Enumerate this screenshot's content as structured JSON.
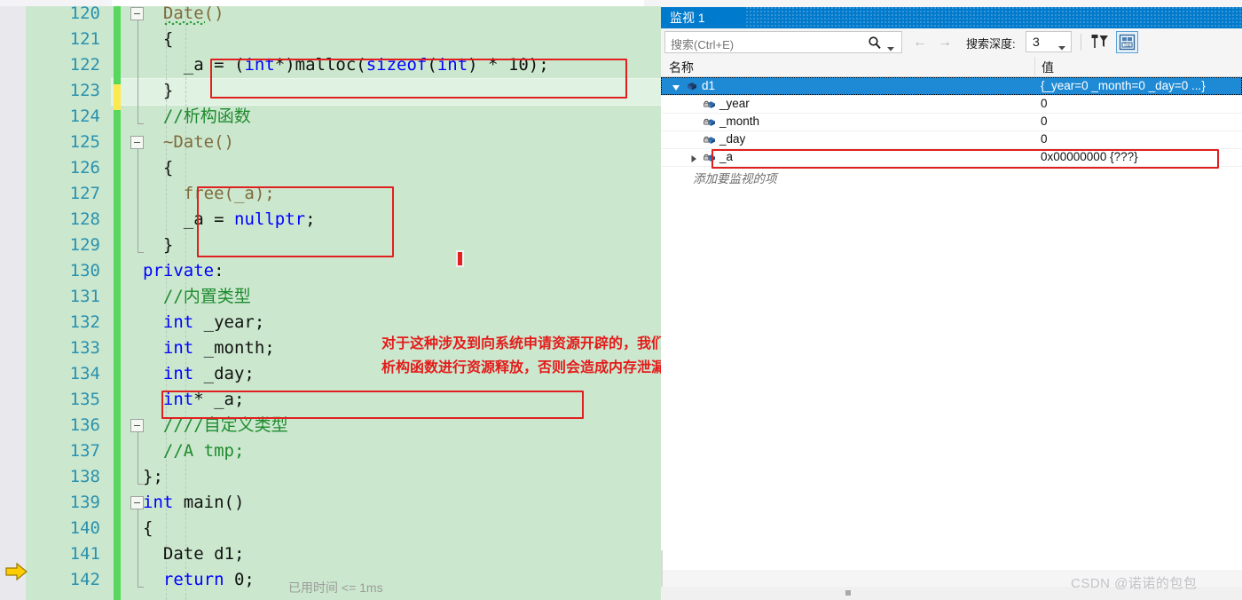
{
  "editor": {
    "first_line_number": 120,
    "line_height": 29,
    "colors": {
      "background": "#cbe8ce",
      "line_number": "#2b91af",
      "keyword": "#0000ff",
      "comment": "#1f8a2f",
      "function": "#7f6a3d",
      "change_bar": "#57d75c",
      "change_bar_unsaved": "#fce94f",
      "annotation": "#e41b1b",
      "highlight_box": "#e02020"
    },
    "lines": [
      {
        "num": "120",
        "tokens": [
          {
            "t": "Date()",
            "c": "fn"
          }
        ],
        "indent": 2,
        "fold": "open",
        "squiggle": true
      },
      {
        "num": "121",
        "tokens": [
          {
            "t": "{",
            "c": "plain"
          }
        ],
        "indent": 2
      },
      {
        "num": "122",
        "tokens": [
          {
            "t": "_a = (",
            "c": "plain"
          },
          {
            "t": "int",
            "c": "kw"
          },
          {
            "t": "*)malloc(",
            "c": "plain"
          },
          {
            "t": "sizeof",
            "c": "kw"
          },
          {
            "t": "(",
            "c": "plain"
          },
          {
            "t": "int",
            "c": "kw"
          },
          {
            "t": ") * 10);",
            "c": "plain"
          }
        ],
        "indent": 4
      },
      {
        "num": "123",
        "tokens": [
          {
            "t": "}",
            "c": "plain"
          }
        ],
        "indent": 2,
        "row_highlight": true,
        "change": "unsaved"
      },
      {
        "num": "124",
        "tokens": [
          {
            "t": "//析构函数",
            "c": "cm"
          }
        ],
        "indent": 2
      },
      {
        "num": "125",
        "tokens": [
          {
            "t": "~Date()",
            "c": "fn"
          }
        ],
        "indent": 2,
        "fold": "open"
      },
      {
        "num": "126",
        "tokens": [
          {
            "t": "{",
            "c": "plain"
          }
        ],
        "indent": 2
      },
      {
        "num": "127",
        "tokens": [
          {
            "t": "free(_a);",
            "c": "fn"
          }
        ],
        "indent": 4
      },
      {
        "num": "128",
        "tokens": [
          {
            "t": "_a = ",
            "c": "plain"
          },
          {
            "t": "nullptr",
            "c": "kw"
          },
          {
            "t": ";",
            "c": "plain"
          }
        ],
        "indent": 4
      },
      {
        "num": "129",
        "tokens": [
          {
            "t": "}",
            "c": "plain"
          }
        ],
        "indent": 2
      },
      {
        "num": "130",
        "tokens": [
          {
            "t": "private",
            "c": "kw"
          },
          {
            "t": ":",
            "c": "plain"
          }
        ],
        "indent": 0
      },
      {
        "num": "131",
        "tokens": [
          {
            "t": "//内置类型",
            "c": "cm"
          }
        ],
        "indent": 2
      },
      {
        "num": "132",
        "tokens": [
          {
            "t": "int",
            "c": "kw"
          },
          {
            "t": " _year;",
            "c": "plain"
          }
        ],
        "indent": 2
      },
      {
        "num": "133",
        "tokens": [
          {
            "t": "int",
            "c": "kw"
          },
          {
            "t": " _month;",
            "c": "plain"
          }
        ],
        "indent": 2
      },
      {
        "num": "134",
        "tokens": [
          {
            "t": "int",
            "c": "kw"
          },
          {
            "t": " _day;",
            "c": "plain"
          }
        ],
        "indent": 2
      },
      {
        "num": "135",
        "tokens": [
          {
            "t": "int",
            "c": "kw"
          },
          {
            "t": "* _a;",
            "c": "plain"
          }
        ],
        "indent": 2
      },
      {
        "num": "136",
        "tokens": [
          {
            "t": "////自定义类型",
            "c": "cm"
          }
        ],
        "indent": 2,
        "fold": "open"
      },
      {
        "num": "137",
        "tokens": [
          {
            "t": "//A tmp;",
            "c": "cm"
          }
        ],
        "indent": 2
      },
      {
        "num": "138",
        "tokens": [
          {
            "t": "};",
            "c": "plain"
          }
        ],
        "indent": 0
      },
      {
        "num": "139",
        "tokens": [
          {
            "t": "int",
            "c": "kw"
          },
          {
            "t": " main()",
            "c": "plain"
          }
        ],
        "indent": 0,
        "fold": "open"
      },
      {
        "num": "140",
        "tokens": [
          {
            "t": "{",
            "c": "plain"
          }
        ],
        "indent": 0
      },
      {
        "num": "141",
        "tokens": [
          {
            "t": "Date d1;",
            "c": "plain"
          }
        ],
        "indent": 2
      },
      {
        "num": "142",
        "tokens": [
          {
            "t": "return",
            "c": "kw"
          },
          {
            "t": " 0;",
            "c": "plain"
          }
        ],
        "indent": 2,
        "current": true
      }
    ],
    "timing_hint": "已用时间 <= 1ms",
    "annotation": {
      "line1": "对于这种涉及到向系统申请资源开辟的，我们必须自己写",
      "line2": "析构函数进行资源释放，否则会造成内存泄漏"
    }
  },
  "watch": {
    "tab_label": "监视 1",
    "search": {
      "placeholder": "搜索(Ctrl+E)"
    },
    "depth": {
      "label": "搜索深度:",
      "value": "3"
    },
    "columns": {
      "name": "名称",
      "value": "值"
    },
    "rows": [
      {
        "name": "d1",
        "value": "{_year=0 _month=0 _day=0 ...}",
        "depth": 0,
        "expanded": true,
        "selected": true,
        "highlighted": false
      },
      {
        "name": "_year",
        "value": "0",
        "depth": 1,
        "expanded": null,
        "selected": false,
        "highlighted": false
      },
      {
        "name": "_month",
        "value": "0",
        "depth": 1,
        "expanded": null,
        "selected": false,
        "highlighted": false
      },
      {
        "name": "_day",
        "value": "0",
        "depth": 1,
        "expanded": null,
        "selected": false,
        "highlighted": false
      },
      {
        "name": "_a",
        "value": "0x00000000 {???}",
        "depth": 1,
        "expanded": false,
        "selected": false,
        "highlighted": true
      }
    ],
    "add_item_hint": "添加要监视的项"
  },
  "watermark": "CSDN @诺诺的包包"
}
